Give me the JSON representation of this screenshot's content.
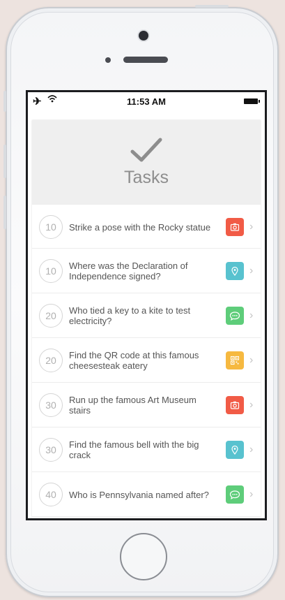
{
  "status_bar": {
    "time": "11:53 AM"
  },
  "header": {
    "title": "Tasks"
  },
  "colors": {
    "photo": "#f15b46",
    "location": "#58c2cf",
    "chat": "#5ecd7a",
    "qr": "#f6b940"
  },
  "tasks": [
    {
      "points": "10",
      "text": "Strike a pose with the Rocky statue",
      "type": "camera-icon",
      "color": "#f15b46"
    },
    {
      "points": "10",
      "text": "Where was the Declaration of Independence signed?",
      "type": "location-pin-icon",
      "color": "#58c2cf"
    },
    {
      "points": "20",
      "text": "Who tied a key to a kite to test electricity?",
      "type": "chat-bubble-icon",
      "color": "#5ecd7a"
    },
    {
      "points": "20",
      "text": "Find the QR code at this famous cheesesteak eatery",
      "type": "qr-code-icon",
      "color": "#f6b940"
    },
    {
      "points": "30",
      "text": "Run up the famous Art Museum stairs",
      "type": "camera-icon",
      "color": "#f15b46"
    },
    {
      "points": "30",
      "text": "Find the famous bell with the big crack",
      "type": "location-pin-icon",
      "color": "#58c2cf"
    },
    {
      "points": "40",
      "text": "Who is Pennsylvania named after?",
      "type": "chat-bubble-icon",
      "color": "#5ecd7a"
    }
  ]
}
